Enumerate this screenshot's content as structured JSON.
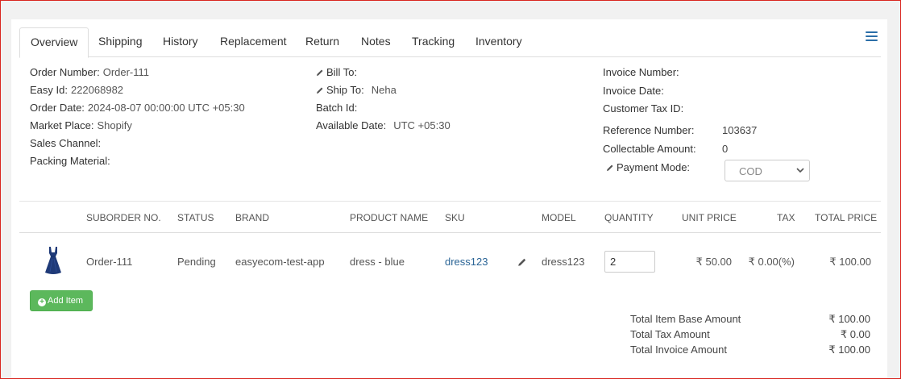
{
  "tabs": [
    "Overview",
    "Shipping",
    "History",
    "Replacement",
    "Return",
    "Notes",
    "Tracking",
    "Inventory"
  ],
  "order": {
    "order_number_label": "Order Number:",
    "order_number": "Order-111",
    "easy_id_label": "Easy Id:",
    "easy_id": "222068982",
    "order_date_label": "Order Date:",
    "order_date": "2024-08-07 00:00:00 UTC +05:30",
    "market_place_label": "Market Place:",
    "market_place": "Shopify",
    "sales_channel_label": "Sales Channel:",
    "packing_material_label": "Packing Material:"
  },
  "address": {
    "bill_to_label": "Bill To:",
    "ship_to_label": "Ship To:",
    "ship_to": "Neha",
    "batch_id_label": "Batch Id:",
    "available_date_label": "Available Date:",
    "available_date": "UTC +05:30"
  },
  "invoice": {
    "invoice_number_label": "Invoice Number:",
    "invoice_date_label": "Invoice Date:",
    "customer_tax_id_label": "Customer Tax ID:",
    "reference_number_label": "Reference Number:",
    "reference_number": "103637",
    "collectable_amount_label": "Collectable Amount:",
    "collectable_amount": "0",
    "payment_mode_label": "Payment Mode:",
    "payment_mode": "COD"
  },
  "table": {
    "headers": [
      "SUBORDER NO.",
      "STATUS",
      "BRAND",
      "PRODUCT NAME",
      "SKU",
      "MODEL",
      "QUANTITY",
      "UNIT PRICE",
      "TAX",
      "TOTAL PRICE"
    ],
    "rows": [
      {
        "suborder": "Order-111",
        "status": "Pending",
        "brand": "easyecom-test-app",
        "product_name": "dress - blue",
        "sku": "dress123",
        "model": "dress123",
        "quantity": "2",
        "unit_price": "₹ 50.00",
        "tax": "₹ 0.00(%)",
        "total_price": "₹ 100.00"
      }
    ]
  },
  "add_item_label": "Add Item",
  "totals": {
    "base_label": "Total Item Base Amount",
    "base": "₹ 100.00",
    "tax_label": "Total Tax Amount",
    "tax": "₹ 0.00",
    "invoice_label": "Total Invoice Amount",
    "invoice": "₹ 100.00"
  },
  "colors": {
    "link": "#2a6496",
    "add_button": "#5cb85c",
    "frame_border": "#d9251f",
    "menu_icon": "#2b6ea8"
  }
}
